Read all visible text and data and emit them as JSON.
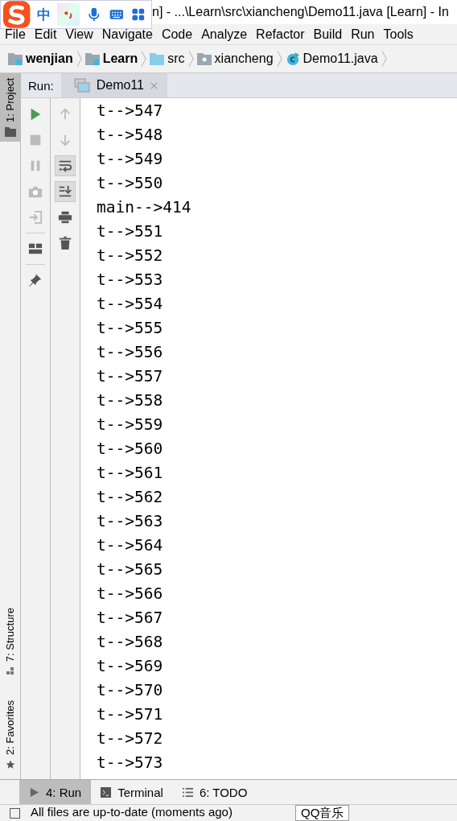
{
  "window": {
    "title": "n] - ...\\Learn\\src\\xiancheng\\Demo11.java [Learn] - In"
  },
  "ime_toolbar": {
    "mode": "中"
  },
  "menu": [
    "File",
    "Edit",
    "View",
    "Navigate",
    "Code",
    "Analyze",
    "Refactor",
    "Build",
    "Run",
    "Tools"
  ],
  "breadcrumbs": [
    {
      "label": "wenjian",
      "kind": "module"
    },
    {
      "label": "Learn",
      "kind": "module"
    },
    {
      "label": "src",
      "kind": "source"
    },
    {
      "label": "xiancheng",
      "kind": "package"
    },
    {
      "label": "Demo11.java",
      "kind": "class"
    }
  ],
  "side_tabs": [
    {
      "label": "1: Project",
      "selected": true,
      "kind": "folder"
    },
    {
      "label": "7: Structure",
      "selected": false,
      "kind": "structure"
    },
    {
      "label": "2: Favorites",
      "selected": false,
      "kind": "star"
    }
  ],
  "run_panel": {
    "label": "Run:",
    "tabs": [
      {
        "label": "Demo11",
        "selected": true
      }
    ],
    "toolbar": [
      {
        "kind": "run",
        "disabled": false
      },
      {
        "kind": "stop",
        "disabled": true
      },
      {
        "kind": "pause",
        "disabled": true
      },
      {
        "kind": "camera",
        "disabled": true
      },
      {
        "kind": "exit",
        "disabled": true
      },
      {
        "kind": "layout",
        "disabled": false
      },
      {
        "kind": "pin",
        "disabled": false
      }
    ],
    "toolbar_2": [
      {
        "kind": "up",
        "selected": false
      },
      {
        "kind": "down",
        "selected": false
      },
      {
        "kind": "wrap",
        "selected": true
      },
      {
        "kind": "scroll",
        "selected": true
      },
      {
        "kind": "print",
        "selected": false
      },
      {
        "kind": "trash",
        "selected": false
      }
    ],
    "output": [
      "t-->547",
      "t-->548",
      "t-->549",
      "t-->550",
      "main-->414",
      "t-->551",
      "t-->552",
      "t-->553",
      "t-->554",
      "t-->555",
      "t-->556",
      "t-->557",
      "t-->558",
      "t-->559",
      "t-->560",
      "t-->561",
      "t-->562",
      "t-->563",
      "t-->564",
      "t-->565",
      "t-->566",
      "t-->567",
      "t-->568",
      "t-->569",
      "t-->570",
      "t-->571",
      "t-->572",
      "t-->573"
    ]
  },
  "bottom_tabs": [
    {
      "label": "4: Run",
      "selected": true,
      "kind": "run"
    },
    {
      "label": "Terminal",
      "selected": false,
      "kind": "terminal"
    },
    {
      "label": "6: TODO",
      "selected": false,
      "kind": "list"
    }
  ],
  "status_bar": {
    "message": "All files are up-to-date (moments ago)"
  },
  "popup": {
    "label": "QQ音乐"
  }
}
